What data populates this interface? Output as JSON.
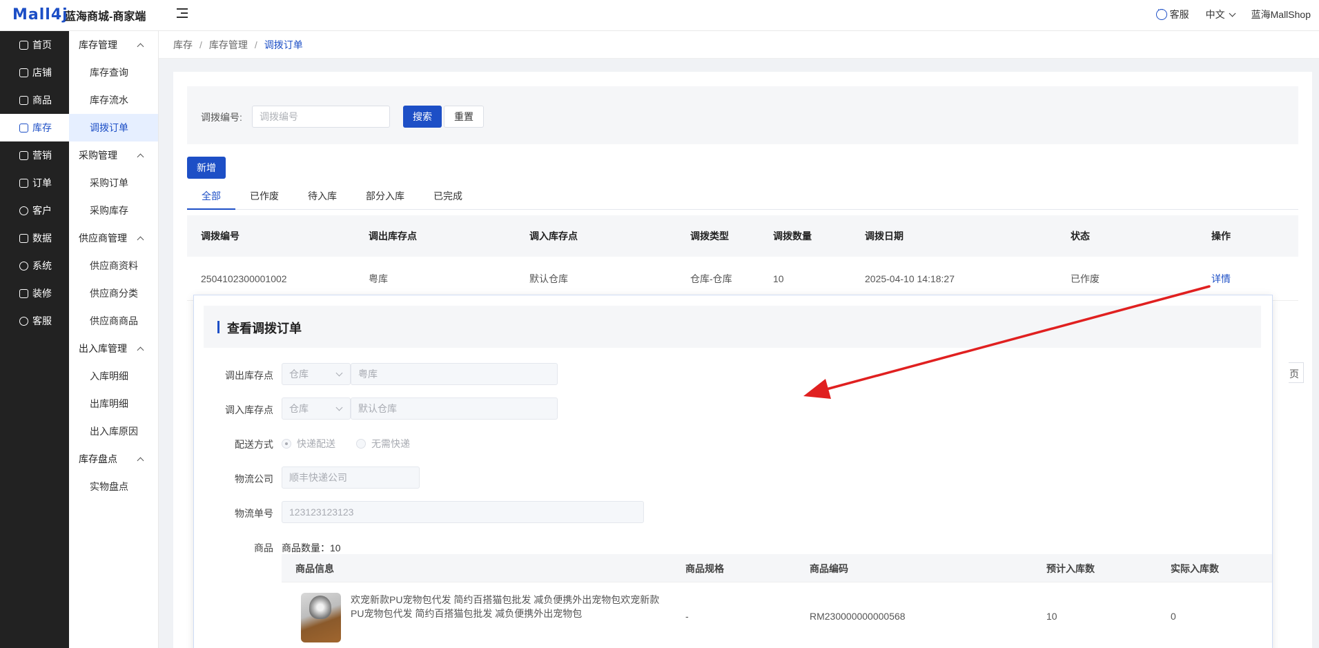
{
  "header": {
    "logo": "Mall4j",
    "app_title": "蓝海商城-商家端",
    "service": "客服",
    "language": "中文",
    "shop_name": "蓝海MallShop"
  },
  "nav": {
    "items": [
      {
        "label": "首页",
        "icon": "home-icon"
      },
      {
        "label": "店铺",
        "icon": "shop-icon"
      },
      {
        "label": "商品",
        "icon": "goods-icon"
      },
      {
        "label": "库存",
        "icon": "inventory-icon"
      },
      {
        "label": "营销",
        "icon": "gift-icon"
      },
      {
        "label": "订单",
        "icon": "order-icon"
      },
      {
        "label": "客户",
        "icon": "users-icon"
      },
      {
        "label": "数据",
        "icon": "data-icon"
      },
      {
        "label": "系统",
        "icon": "settings-icon"
      },
      {
        "label": "装修",
        "icon": "decor-icon"
      },
      {
        "label": "客服",
        "icon": "chat-icon"
      }
    ]
  },
  "subnav": {
    "g1": "库存管理",
    "g1_items": [
      "库存查询",
      "库存流水",
      "调拨订单"
    ],
    "g2": "采购管理",
    "g2_items": [
      "采购订单",
      "采购库存"
    ],
    "g3": "供应商管理",
    "g3_items": [
      "供应商资料",
      "供应商分类",
      "供应商商品"
    ],
    "g4": "出入库管理",
    "g4_items": [
      "入库明细",
      "出库明细",
      "出入库原因"
    ],
    "g5": "库存盘点",
    "g5_items": [
      "实物盘点"
    ]
  },
  "breadcrumb": [
    "库存",
    "库存管理",
    "调拨订单"
  ],
  "search": {
    "label": "调拨编号:",
    "placeholder": "调拨编号",
    "search_btn": "搜索",
    "reset_btn": "重置"
  },
  "add_btn": "新增",
  "tabs": [
    "全部",
    "已作废",
    "待入库",
    "部分入库",
    "已完成"
  ],
  "table": {
    "columns": [
      "调拨编号",
      "调出库存点",
      "调入库存点",
      "调拨类型",
      "调拨数量",
      "调拨日期",
      "状态",
      "操作"
    ],
    "rows": [
      {
        "no": "2504102300001002",
        "from": "粤库",
        "to": "默认仓库",
        "type": "仓库-仓库",
        "qty": "10",
        "date": "2025-04-10 14:18:27",
        "status": "已作废",
        "op": "详情"
      }
    ]
  },
  "pager": {
    "page_suffix": "页"
  },
  "modal": {
    "title": "查看调拨订单",
    "out_label": "调出库存点",
    "out_type": "仓库",
    "out_value": "粤库",
    "in_label": "调入库存点",
    "in_type": "仓库",
    "in_value": "默认仓库",
    "delivery_label": "配送方式",
    "delivery_opt1": "快递配送",
    "delivery_opt2": "无需快递",
    "company_label": "物流公司",
    "company_value": "顺丰快递公司",
    "tracking_label": "物流单号",
    "tracking_value": "123123123123",
    "goods_label": "商品",
    "goods_count": "商品数量：10",
    "goods_columns": [
      "商品信息",
      "商品规格",
      "商品编码",
      "预计入库数",
      "实际入库数"
    ],
    "goods": {
      "name": "欢宠新款PU宠物包代发 简约百搭猫包批发 减负便携外出宠物包欢宠新款PU宠物包代发 简约百搭猫包批发 减负便携外出宠物包",
      "spec": "-",
      "code": "RM230000000000568",
      "expected": "10",
      "actual": "0"
    }
  },
  "colors": {
    "accent": "#1d4fc6",
    "arrow": "#e02020",
    "nav_bg": "#222222"
  }
}
